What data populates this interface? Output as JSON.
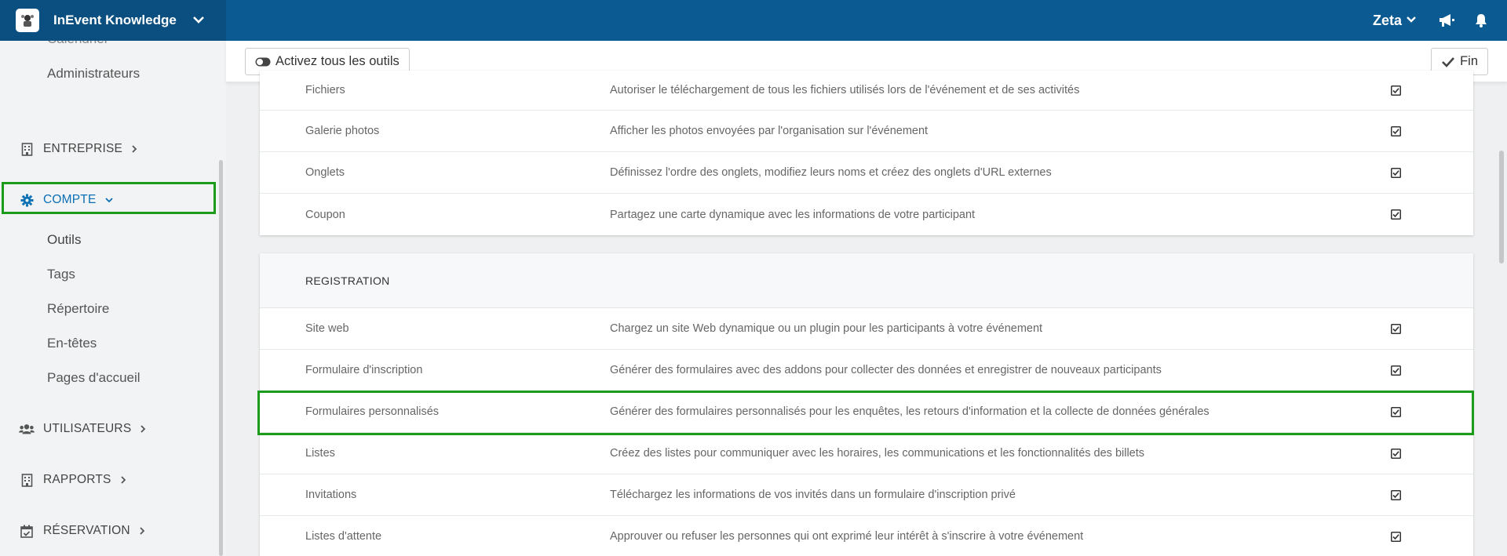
{
  "app": {
    "title": "InEvent Knowledge",
    "user": "Zeta"
  },
  "colors": {
    "topbar": "#0b5a91",
    "accent": "#0b6fb4",
    "highlight": "#1a9b1a"
  },
  "sidebar": {
    "cut_label": "Calendrier",
    "admins_label": "Administrateurs",
    "sections": {
      "entreprise": "ENTREPRISE",
      "compte": "COMPTE",
      "utilisateurs": "UTILISATEURS",
      "rapports": "RAPPORTS",
      "reservation": "RÉSERVATION"
    },
    "compte_items": [
      "Outils",
      "Tags",
      "Répertoire",
      "En-têtes",
      "Pages d'accueil"
    ]
  },
  "actions": {
    "activate_all": "Activez tous les outils",
    "finish": "Fin"
  },
  "tools_top": [
    {
      "name": "Fichiers",
      "desc": "Autoriser le téléchargement de tous les fichiers utilisés lors de l'événement et de ses activités",
      "checked": true
    },
    {
      "name": "Galerie photos",
      "desc": "Afficher les photos envoyées par l'organisation sur l'événement",
      "checked": true
    },
    {
      "name": "Onglets",
      "desc": "Définissez l'ordre des onglets, modifiez leurs noms et créez des onglets d'URL externes",
      "checked": true
    },
    {
      "name": "Coupon",
      "desc": "Partagez une carte dynamique avec les informations de votre participant",
      "checked": true
    }
  ],
  "registration": {
    "header": "REGISTRATION",
    "tools": [
      {
        "name": "Site web",
        "desc": "Chargez un site Web dynamique ou un plugin pour les participants à votre événement",
        "checked": true
      },
      {
        "name": "Formulaire d'inscription",
        "desc": "Générer des formulaires avec des addons pour collecter des données et enregistrer de nouveaux participants",
        "checked": true
      },
      {
        "name": "Formulaires personnalisés",
        "desc": "Générer des formulaires personnalisés pour les enquêtes, les retours d'information et la collecte de données générales",
        "checked": true
      },
      {
        "name": "Listes",
        "desc": "Créez des listes pour communiquer avec les horaires, les communications et les fonctionnalités des billets",
        "checked": true
      },
      {
        "name": "Invitations",
        "desc": "Téléchargez les informations de vos invités dans un formulaire d'inscription privé",
        "checked": true
      },
      {
        "name": "Listes d'attente",
        "desc": "Approuver ou refuser les personnes qui ont exprimé leur intérêt à s'inscrire à votre événement",
        "checked": true
      }
    ]
  }
}
